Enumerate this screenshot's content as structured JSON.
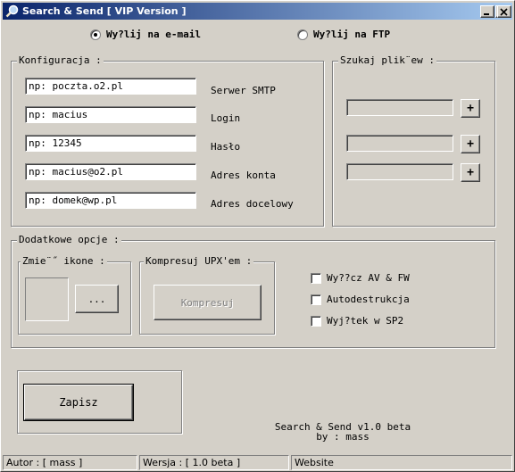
{
  "window": {
    "title": "Search & Send [ VIP Version ]"
  },
  "mode": {
    "email_label": "Wy?lij na e-mail",
    "ftp_label": "Wy?lij na FTP",
    "selected": "email"
  },
  "config": {
    "title": "Konfiguracja :",
    "fields": [
      {
        "value": "np: poczta.o2.pl",
        "label": "Serwer SMTP"
      },
      {
        "value": "np: macius",
        "label": "Login"
      },
      {
        "value": "np: 12345",
        "label": "Hasło"
      },
      {
        "value": "np: macius@o2.pl",
        "label": "Adres konta"
      },
      {
        "value": "np: domek@wp.pl",
        "label": "Adres docelowy"
      }
    ]
  },
  "search": {
    "title": "Szukaj plik¨ew :",
    "add_label": "+",
    "rows": [
      {
        "value": ""
      },
      {
        "value": ""
      },
      {
        "value": ""
      }
    ]
  },
  "extra": {
    "title": "Dodatkowe opcje :",
    "icon_group": {
      "title": "Zmie¨˝ ikone :",
      "browse_label": "..."
    },
    "upx_group": {
      "title": "Kompresuj UPX'em :",
      "compress_label": "Kompresuj"
    },
    "options": [
      {
        "label": "Wy??cz AV & FW",
        "checked": false
      },
      {
        "label": "Autodestrukcja",
        "checked": false
      },
      {
        "label": "Wyj?tek w SP2",
        "checked": false
      }
    ]
  },
  "save": {
    "label": "Zapisz"
  },
  "footer": {
    "line1": "Search & Send v1.0 beta",
    "line2": "by : mass"
  },
  "status": {
    "author": "Autor : [ mass ]",
    "version": "Wersja : [ 1.0 beta ]",
    "website": "Website"
  },
  "colors": {
    "title_start": "#0a246a",
    "title_end": "#a6caf0",
    "face": "#d4d0c8"
  }
}
